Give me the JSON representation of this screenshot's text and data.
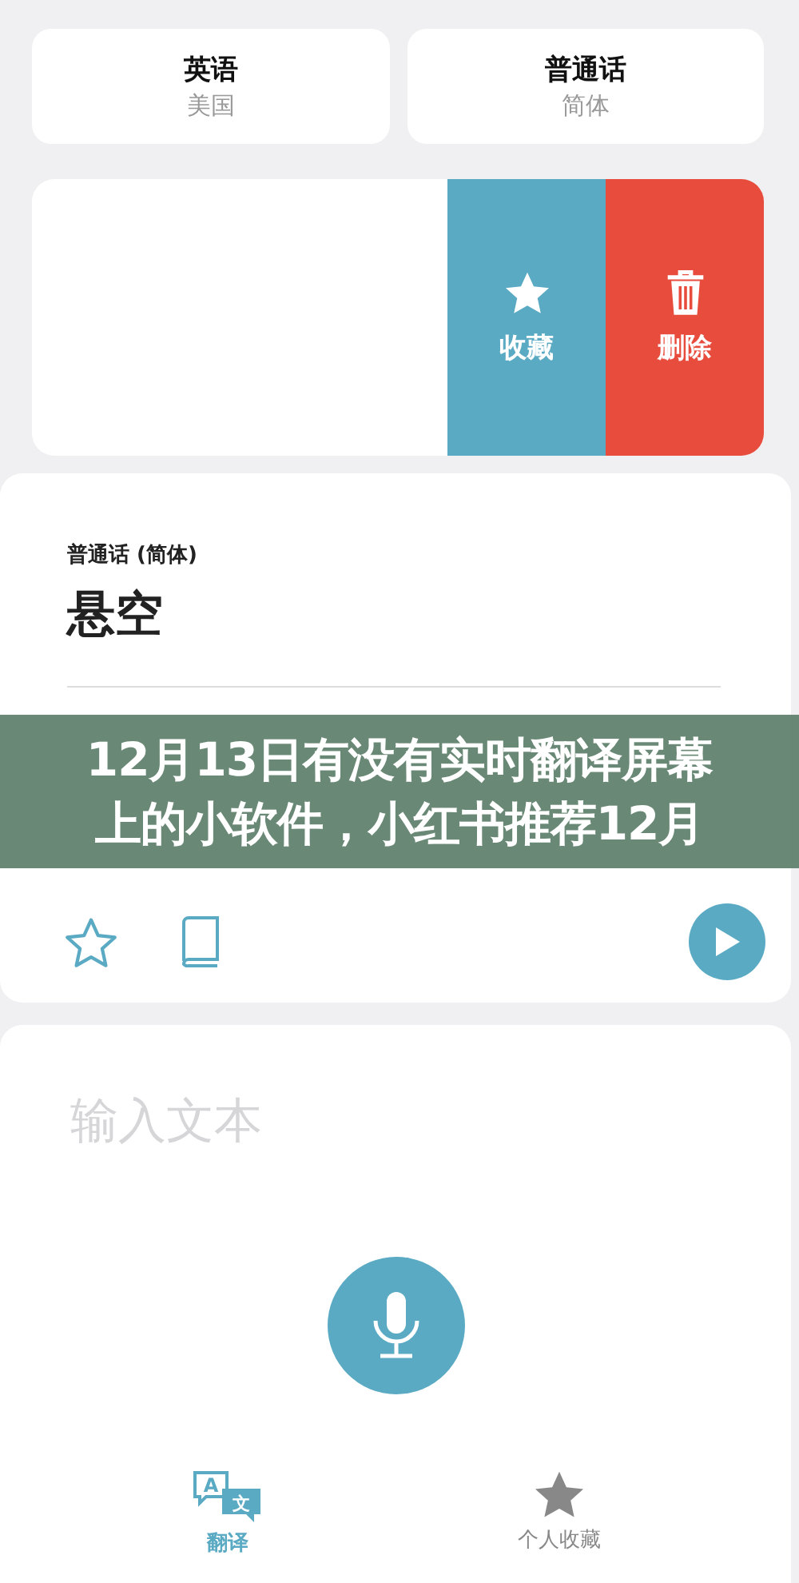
{
  "languages": [
    {
      "name": "英语",
      "variant": "美国"
    },
    {
      "name": "普通话",
      "variant": "简体"
    }
  ],
  "swipe_actions": [
    {
      "kind": "favorite",
      "label": "收藏"
    },
    {
      "kind": "delete",
      "label": "删除"
    }
  ],
  "result": {
    "source_label": "普通话 (简体)",
    "source_text": "悬空"
  },
  "banner": {
    "lines": [
      "12月13日有没有实时翻译屏幕",
      "上的小软件，小红书推荐12月"
    ]
  },
  "input": {
    "placeholder": "输入文本"
  },
  "tabs": [
    {
      "kind": "translate",
      "label": "翻译",
      "glyphs": [
        "A",
        "文"
      ],
      "selected": true
    },
    {
      "kind": "favorites",
      "label": "个人收藏",
      "selected": false
    }
  ]
}
